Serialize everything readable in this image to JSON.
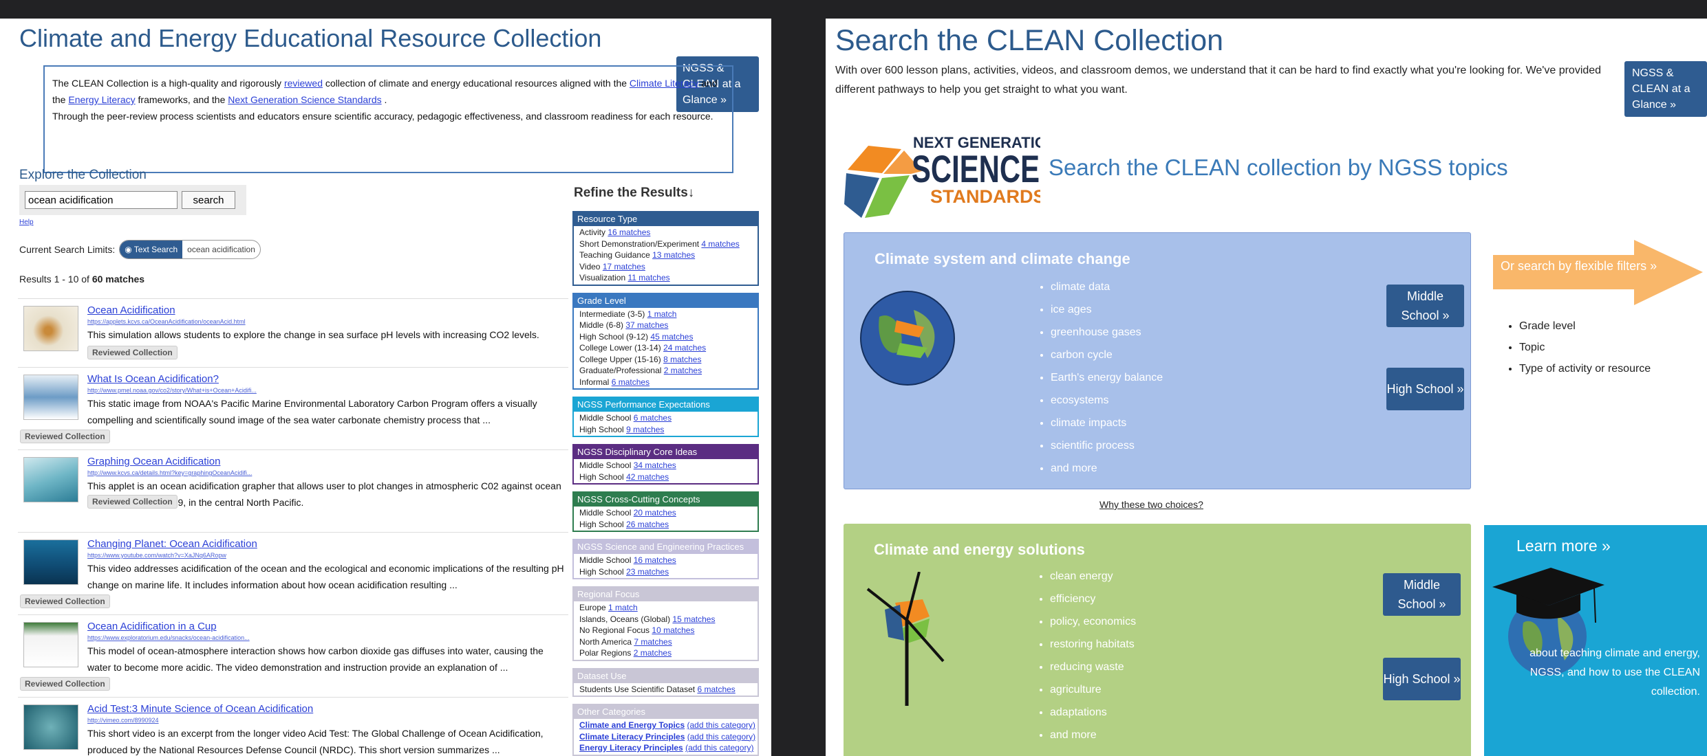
{
  "left": {
    "title": "Climate and Energy Educational Resource Collection",
    "glance_button": "NGSS & CLEAN at a Glance »",
    "intro": {
      "p1_a": "The CLEAN Collection is a high-quality and rigorously",
      "link_reviewed": "reviewed",
      "p1_b": "collection of climate and energy educational resources aligned with the",
      "link_climate": "Climate Literacy",
      "p1_c": "and the",
      "link_energy": "Energy Literacy",
      "p1_d": "frameworks, and the",
      "link_ngss": "Next Generation Science Standards",
      "p1_e": ".",
      "p2": "Through the peer-review process scientists and educators ensure scientific accuracy, pedagogic effectiveness, and classroom readiness for each resource."
    },
    "explore_heading": "Explore the Collection",
    "search": {
      "value": "ocean acidification",
      "button": "search"
    },
    "help": "Help",
    "limits": {
      "label": "Current Search Limits:",
      "chip_label": "Text Search",
      "chip_value": "ocean acidification"
    },
    "results_count": {
      "prefix": "Results 1 - 10 of ",
      "count": "60 matches"
    },
    "results": [
      {
        "title": "Ocean Acidification",
        "url": "https://applets.kcvs.ca/OceanAcidification/oceanAcid.html",
        "desc": "This simulation allows students to explore the change in sea surface pH levels with increasing CO2 levels.",
        "badge": "Reviewed Collection"
      },
      {
        "title": "What Is Ocean Acidification?",
        "url": "http://www.pmel.noaa.gov/co2/story/What+is+Ocean+Acidifi...",
        "desc": "This static image from NOAA's Pacific Marine Environmental Laboratory Carbon Program offers a visually compelling and scientifically sound image of the sea water carbonate chemistry process that ...",
        "badge": "Reviewed Collection"
      },
      {
        "title": "Graphing Ocean Acidification",
        "url": "http://www.kcvs.ca/details.html?key=graphingOceanAcidifi...",
        "desc": "This applet is an ocean acidification grapher that allows user to plot changes in atmospheric C02 against ocean pH, from 1988 to 2009, in the central North Pacific.",
        "badge": "Reviewed Collection"
      },
      {
        "title": "Changing Planet: Ocean Acidification",
        "url": "https://www.youtube.com/watch?v=XaJNq6ARopw",
        "desc": "This video addresses acidification of the ocean and the ecological and economic implications of the resulting pH change on marine life. It includes information about how ocean acidification resulting ...",
        "badge": "Reviewed Collection"
      },
      {
        "title": "Ocean Acidification in a Cup",
        "url": "https://www.exploratorium.edu/snacks/ocean-acidification...",
        "desc": "This model of ocean-atmosphere interaction shows how carbon dioxide gas diffuses into water, causing the water to become more acidic. The video demonstration and instruction provide an explanation of ...",
        "badge": "Reviewed Collection"
      },
      {
        "title": "Acid Test:3 Minute Science of Ocean Acidification",
        "url": "http://vimeo.com/8990924",
        "desc": "This short video is an excerpt from the longer video Acid Test: The Global Challenge of Ocean Acidification, produced by the National Resources Defense Council (NRDC). This short version summarizes ...",
        "badge": ""
      }
    ],
    "refine_heading": "Refine the Results↓",
    "facets": [
      {
        "title": "Resource Type",
        "color": "#2f5c91",
        "items": [
          {
            "label": "Activity",
            "link": "16 matches"
          },
          {
            "label": "Short Demonstration/Experiment",
            "link": "4 matches"
          },
          {
            "label": "Teaching Guidance",
            "link": "13 matches"
          },
          {
            "label": "Video",
            "link": "17 matches"
          },
          {
            "label": "Visualization",
            "link": "11 matches"
          }
        ]
      },
      {
        "title": "Grade Level",
        "color": "#3a78c0",
        "items": [
          {
            "label": "Intermediate (3-5)",
            "link": "1 match"
          },
          {
            "label": "Middle (6-8)",
            "link": "37 matches"
          },
          {
            "label": "High School (9-12)",
            "link": "45 matches"
          },
          {
            "label": "College Lower (13-14)",
            "link": "24 matches"
          },
          {
            "label": "College Upper (15-16)",
            "link": "8 matches"
          },
          {
            "label": "Graduate/Professional",
            "link": "2 matches"
          },
          {
            "label": "Informal",
            "link": "6 matches"
          }
        ]
      },
      {
        "title": "NGSS Performance Expectations",
        "color": "#1aa5d4",
        "items": [
          {
            "label": "Middle School",
            "link": "6 matches"
          },
          {
            "label": "High School",
            "link": "9 matches"
          }
        ]
      },
      {
        "title": "NGSS Disciplinary Core Ideas",
        "color": "#5b2d82",
        "items": [
          {
            "label": "Middle School",
            "link": "34 matches"
          },
          {
            "label": "High School",
            "link": "42 matches"
          }
        ]
      },
      {
        "title": "NGSS Cross-Cutting Concepts",
        "color": "#2e7d4f",
        "items": [
          {
            "label": "Middle School",
            "link": "20 matches"
          },
          {
            "label": "High School",
            "link": "26 matches"
          }
        ]
      },
      {
        "title": "NGSS Science and Engineering Practices",
        "color": "#c3bfdc",
        "items": [
          {
            "label": "Middle School",
            "link": "16 matches"
          },
          {
            "label": "High School",
            "link": "23 matches"
          }
        ]
      },
      {
        "title": "Regional Focus",
        "color": "#c9c6d6",
        "items": [
          {
            "label": "Europe",
            "link": "1 match"
          },
          {
            "label": "Islands, Oceans (Global)",
            "link": "15 matches"
          },
          {
            "label": "No Regional Focus",
            "link": "10 matches"
          },
          {
            "label": "North America",
            "link": "7 matches"
          },
          {
            "label": "Polar Regions",
            "link": "2 matches"
          }
        ]
      },
      {
        "title": "Dataset Use",
        "color": "#c9c6d6",
        "items": [
          {
            "label": "Students Use Scientific Dataset",
            "link": "6 matches"
          }
        ]
      },
      {
        "title": "Other Categories",
        "color": "#c9c6d6",
        "items": [
          {
            "label": "Climate and Energy Topics",
            "link": "(add this category)"
          },
          {
            "label": "Climate Literacy Principles",
            "link": "(add this category)"
          },
          {
            "label": "Energy Literacy Principles",
            "link": "(add this category)"
          }
        ]
      }
    ]
  },
  "right": {
    "title": "Search the CLEAN Collection",
    "glance_button": "NGSS & CLEAN at a Glance »",
    "intro": "With over 600 lesson plans, activities, videos, and classroom demos, we understand that it can be hard to find exactly what you're looking for. We've provided different pathways to help you get straight to what you want.",
    "logo": {
      "line1": "NEXT GENERATION",
      "line2": "SCIENCE",
      "line3": "STANDARDS"
    },
    "ngss_heading": "Search the CLEAN collection by NGSS topics",
    "tile1": {
      "title": "Climate system and climate change",
      "items": [
        "climate data",
        "ice ages",
        "greenhouse gases",
        "carbon cycle",
        "Earth's energy balance",
        "ecosystems",
        "climate impacts",
        "scientific process",
        "and more"
      ],
      "middle": "Middle School »",
      "high": "High School »",
      "color": "#a8c0ea"
    },
    "why": "Why these two choices?",
    "tile2": {
      "title": "Climate and energy solutions",
      "items": [
        "clean energy",
        "efficiency",
        "policy, economics",
        "restoring habitats",
        "reducing waste",
        "agriculture",
        "adaptations",
        "and more"
      ],
      "middle": "Middle School »",
      "high": "High School »",
      "color": "#b3d084"
    },
    "flex": {
      "arrow_text": "Or search by flexible filters »",
      "arrow_color": "#f9b76a",
      "items": [
        "Grade level",
        "Topic",
        "Type of activity or resource"
      ]
    },
    "learn": {
      "title": "Learn more »",
      "desc": "about teaching climate and energy, NGSS, and how to use the CLEAN collection.",
      "color": "#1aa5d4"
    }
  }
}
